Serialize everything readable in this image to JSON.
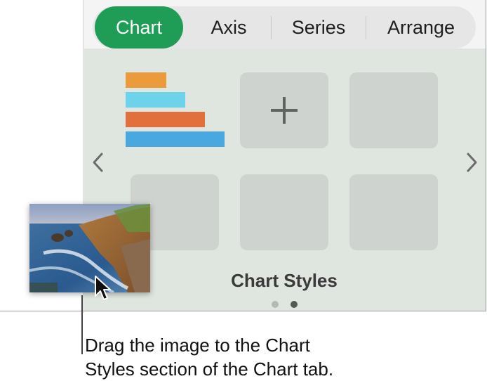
{
  "tabs": [
    {
      "label": "Chart",
      "active": true
    },
    {
      "label": "Axis",
      "active": false
    },
    {
      "label": "Series",
      "active": false
    },
    {
      "label": "Arrange",
      "active": false
    }
  ],
  "chart_styles": {
    "title": "Chart Styles",
    "page_indicator": {
      "pages": 2,
      "current": 2
    },
    "prev_icon": "chevron-left-icon",
    "next_icon": "chevron-right-icon",
    "add_icon": "plus-icon",
    "preview_bar_colors": [
      "#eb9a3c",
      "#6cd3ea",
      "#e2703c",
      "#4aa8e0"
    ]
  },
  "callout": {
    "text_line1": "Drag the image to the Chart",
    "text_line2": "Styles section of the Chart tab."
  },
  "colors": {
    "accent": "#1f9c55",
    "panel": "#dfe6e0",
    "swatch": "#cfd3cf"
  }
}
